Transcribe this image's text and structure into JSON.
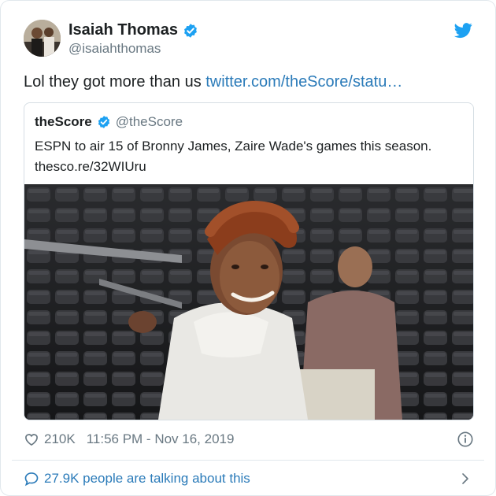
{
  "author": {
    "name": "Isaiah Thomas",
    "handle": "@isaiahthomas"
  },
  "tweet": {
    "text": "Lol they got more than us ",
    "link_text": "twitter.com/theScore/statu…"
  },
  "quoted": {
    "name": "theScore",
    "handle": "@theScore",
    "text": "ESPN to air 15 of Bronny James, Zaire Wade's games this season.",
    "link": "thesco.re/32WIUru"
  },
  "footer": {
    "likes": "210K",
    "timestamp": "11:56 PM - Nov 16, 2019",
    "talking": "27.9K people are talking about this"
  },
  "colors": {
    "twitter_blue": "#1da1f2",
    "link_blue": "#2b7bb9",
    "muted": "#697882"
  },
  "icons": [
    "verified-icon",
    "twitter-bird-icon",
    "heart-icon",
    "info-icon",
    "reply-bubble-icon",
    "chevron-right-icon"
  ]
}
